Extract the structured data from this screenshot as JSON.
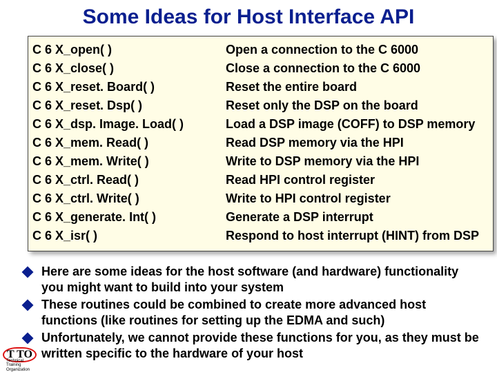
{
  "title": "Some Ideas for Host Interface API",
  "api": [
    {
      "fn": "C 6 X_open( )",
      "desc": "Open a connection to the C 6000"
    },
    {
      "fn": "C 6 X_close( )",
      "desc": "Close a connection to the C 6000"
    },
    {
      "fn": "C 6 X_reset. Board( )",
      "desc": "Reset the entire board"
    },
    {
      "fn": "C 6 X_reset. Dsp( )",
      "desc": "Reset only the DSP on the board"
    },
    {
      "fn": "C 6 X_dsp. Image. Load( )",
      "desc": "Load a DSP image (COFF) to DSP memory"
    },
    {
      "fn": "C 6 X_mem. Read( )",
      "desc": "Read DSP memory via the HPI"
    },
    {
      "fn": "C 6 X_mem. Write( )",
      "desc": "Write to DSP memory via the HPI"
    },
    {
      "fn": "C 6 X_ctrl. Read( )",
      "desc": "Read HPI control register"
    },
    {
      "fn": "C 6 X_ctrl. Write( )",
      "desc": "Write to HPI control register"
    },
    {
      "fn": "C 6 X_generate. Int( )",
      "desc": "Generate a DSP interrupt"
    },
    {
      "fn": "C 6 X_isr( )",
      "desc": "Respond to host interrupt (HINT) from DSP"
    }
  ],
  "bullets": [
    "Here are some ideas for the host software (and hardware) functionality you might want to build into your system",
    "These routines could be combined to create more advanced host functions (like routines for setting up the EDMA and such)",
    "Unfortunately, we cannot provide these functions for you, as they must be written specific to the hardware of your host"
  ],
  "footer": {
    "badge": "T TO",
    "sub1": "Technical",
    "sub2": "Training",
    "sub3": "Organization"
  }
}
